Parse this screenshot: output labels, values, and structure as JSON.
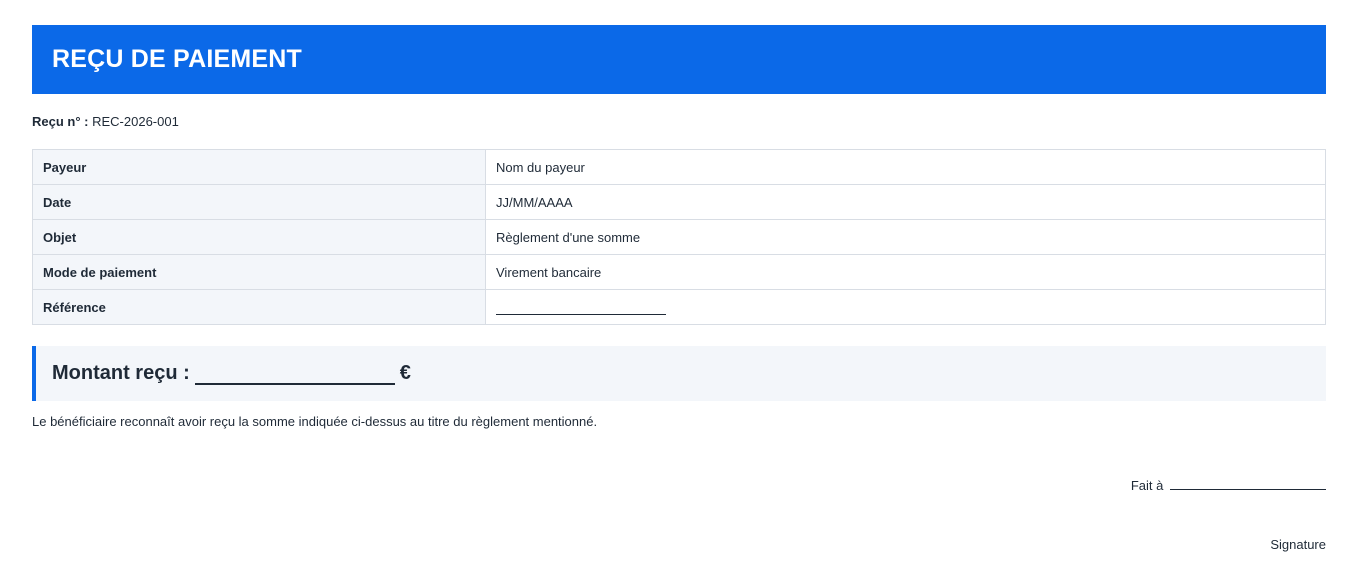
{
  "header": {
    "title": "REÇU DE PAIEMENT"
  },
  "receipt": {
    "number_label": "Reçu n° :",
    "number_value": "REC-2026-001"
  },
  "details": [
    {
      "label": "Payeur",
      "value": "Nom du payeur"
    },
    {
      "label": "Date",
      "value": "JJ/MM/AAAA"
    },
    {
      "label": "Objet",
      "value": "Règlement d'une somme"
    },
    {
      "label": "Mode de paiement",
      "value": "Virement bancaire"
    },
    {
      "label": "Référence",
      "value": ""
    }
  ],
  "amount": {
    "label": "Montant reçu :",
    "currency": "€"
  },
  "acknowledgement": "Le bénéficiaire reconnaît avoir reçu la somme indiquée ci-dessus au titre du règlement mentionné.",
  "footer": {
    "place_label": "Fait à",
    "signature_label": "Signature"
  },
  "colors": {
    "accent": "#0b69e8",
    "label_background": "#f3f6fa",
    "border": "#d8dde4",
    "text": "#1f2a37"
  }
}
